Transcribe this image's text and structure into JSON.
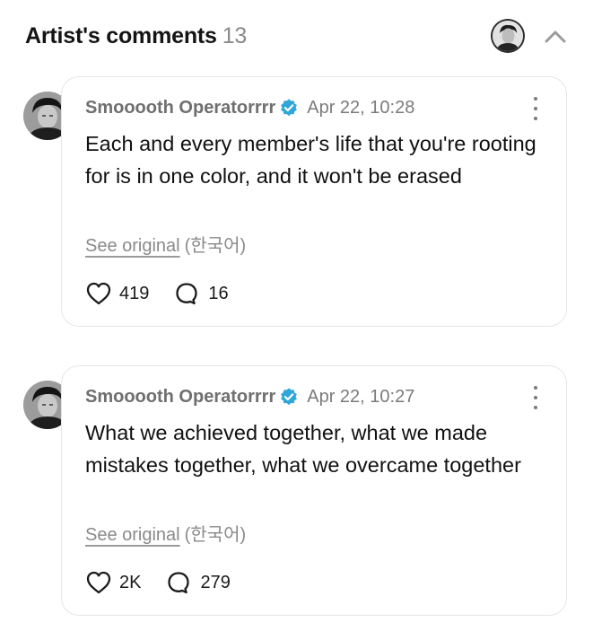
{
  "header": {
    "title": "Artist's comments",
    "count": "13"
  },
  "comments": [
    {
      "author": "Smooooth Operatorrrr",
      "timestamp": "Apr 22, 10:28",
      "text": "Each and every member's life that you're rooting for is in one color, and it won't be erased",
      "see_original": "See original",
      "language": "(한국어)",
      "likes": "419",
      "replies": "16"
    },
    {
      "author": "Smooooth Operatorrrr",
      "timestamp": "Apr 22, 10:27",
      "text": "What we achieved together, what we made mistakes together, what we overcame together",
      "see_original": "See original",
      "language": "(한국어)",
      "likes": "2K",
      "replies": "279"
    }
  ],
  "icons": {
    "verified": "verified-badge-icon",
    "more": "more-vertical-icon",
    "like": "heart-icon",
    "reply": "speech-bubble-icon",
    "collapse": "chevron-up-icon"
  },
  "colors": {
    "verified_badge": "#2fa7d8",
    "muted_text": "#7b7b7b",
    "card_border": "#e6e6e6"
  }
}
